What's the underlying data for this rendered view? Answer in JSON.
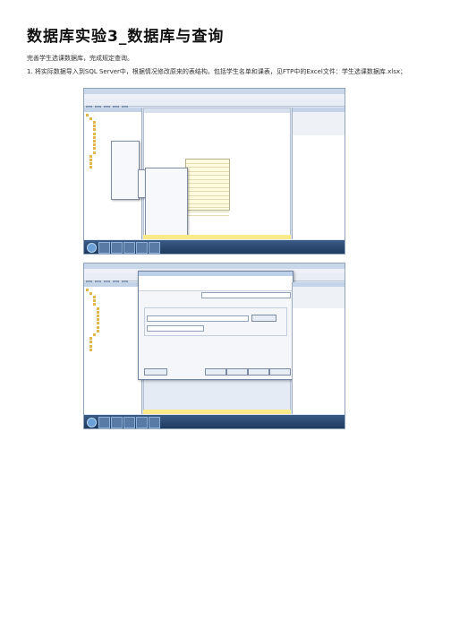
{
  "doc": {
    "title": "数据库实验3_数据库与查询",
    "intro": "完善学生选课数据库，完成规定查询。",
    "step1": "1. 将实际数据导入到SQL Server中，根据情况修改原来的表结构。包括学生名单和课表，见FTP中的Excel文件：学生选课数据库.xlsx；"
  }
}
